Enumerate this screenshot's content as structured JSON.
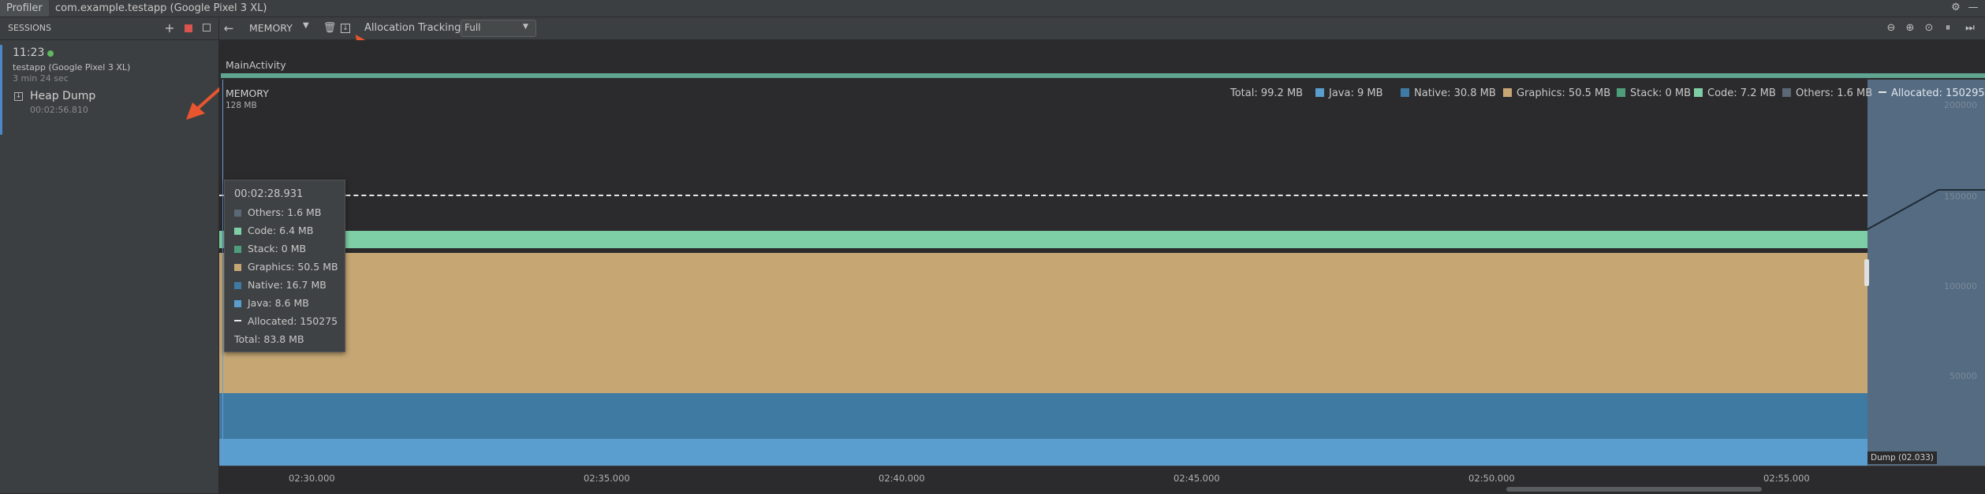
{
  "tabs": {
    "profiler": "Profiler",
    "app": "com.example.testapp (Google Pixel 3 XL)"
  },
  "sessions": {
    "title": "SESSIONS",
    "time": "11:23",
    "device": "testapp (Google Pixel 3 XL)",
    "duration": "3 min 24 sec",
    "heap_dump_label": "Heap Dump",
    "heap_dump_time": "00:02:56.810"
  },
  "toolbar": {
    "profiler_name": "MEMORY",
    "alloc_label": "Allocation Tracking",
    "alloc_value": "Full"
  },
  "activity": {
    "label": "MainActivity"
  },
  "chart": {
    "title": "MEMORY",
    "max_label": "128 MB",
    "legend": {
      "total": "Total: 99.2 MB",
      "java": "Java: 9 MB",
      "native": "Native: 30.8 MB",
      "graphics": "Graphics: 50.5 MB",
      "stack": "Stack: 0 MB",
      "code": "Code: 7.2 MB",
      "others": "Others: 1.6 MB",
      "allocated": "Allocated: 150295"
    },
    "yticks": [
      "200000",
      "150000",
      "100000",
      "50000"
    ],
    "xticks": [
      "02:30.000",
      "02:35.000",
      "02:40.000",
      "02:45.000",
      "02:50.000",
      "02:55.000"
    ],
    "dump_label": "Dump (02.033)",
    "colors": {
      "java": "#5a9ecf",
      "native": "#3f7aa3",
      "graphics": "#c6a774",
      "stack": "#4f9e7b",
      "code": "#7fcfa6",
      "others": "#5b6875",
      "activity": "#5fa590"
    }
  },
  "tooltip": {
    "time": "00:02:28.931",
    "others": "Others: 1.6 MB",
    "code": "Code: 6.4 MB",
    "stack": "Stack: 0 MB",
    "graphics": "Graphics: 50.5 MB",
    "native": "Native: 16.7 MB",
    "java": "Java: 8.6 MB",
    "allocated": "Allocated: 150275",
    "total": "Total: 83.8 MB"
  }
}
